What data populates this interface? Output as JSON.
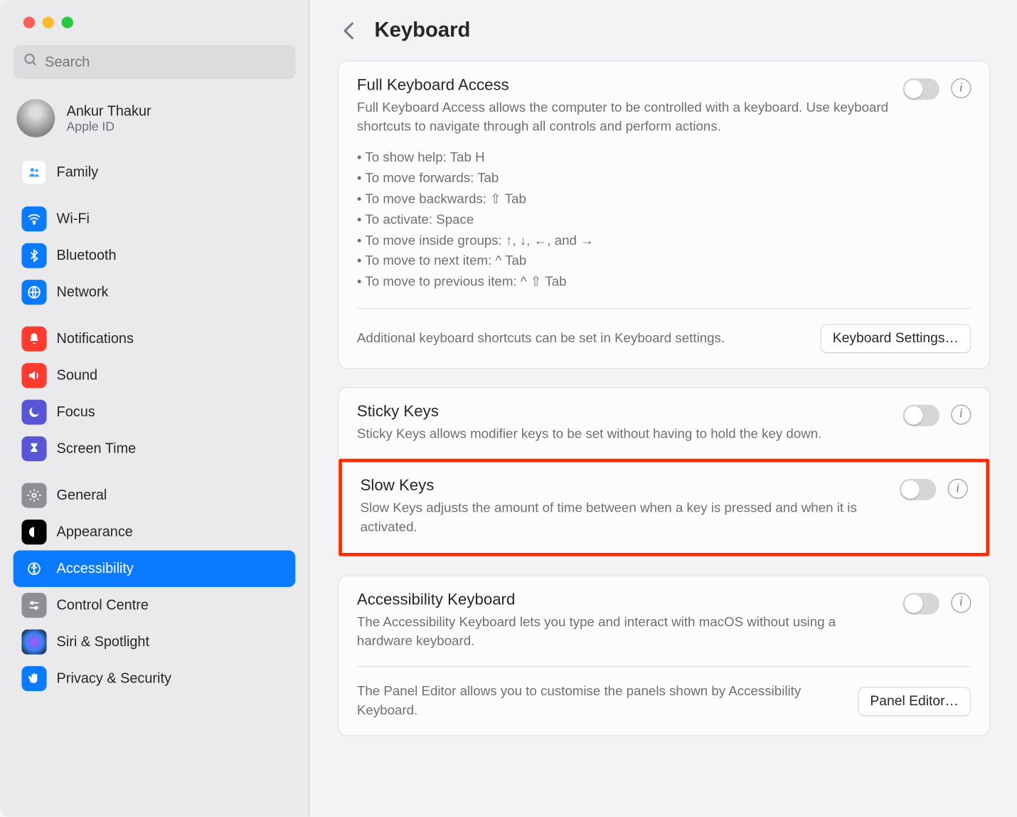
{
  "header": {
    "page_title": "Keyboard"
  },
  "search": {
    "placeholder": "Search"
  },
  "account": {
    "name": "Ankur Thakur",
    "sub": "Apple ID"
  },
  "sidebar": {
    "items": [
      {
        "label": "Family"
      },
      {
        "label": "Wi-Fi"
      },
      {
        "label": "Bluetooth"
      },
      {
        "label": "Network"
      },
      {
        "label": "Notifications"
      },
      {
        "label": "Sound"
      },
      {
        "label": "Focus"
      },
      {
        "label": "Screen Time"
      },
      {
        "label": "General"
      },
      {
        "label": "Appearance"
      },
      {
        "label": "Accessibility"
      },
      {
        "label": "Control Centre"
      },
      {
        "label": "Siri & Spotlight"
      },
      {
        "label": "Privacy & Security"
      }
    ]
  },
  "panels": {
    "full_keyboard": {
      "title": "Full Keyboard Access",
      "desc": "Full Keyboard Access allows the computer to be controlled with a keyboard. Use keyboard shortcuts to navigate through all controls and perform actions.",
      "shortcuts": [
        "To show help: Tab H",
        "To move forwards: Tab",
        "To move backwards: ⇧ Tab",
        "To activate: Space",
        "To move inside groups: ↑, ↓, ←, and →",
        "To move to next item: ^ Tab",
        "To move to previous item: ^ ⇧ Tab"
      ],
      "footer_text": "Additional keyboard shortcuts can be set in Keyboard settings.",
      "button": "Keyboard Settings…"
    },
    "sticky": {
      "title": "Sticky Keys",
      "desc": "Sticky Keys allows modifier keys to be set without having to hold the key down."
    },
    "slow": {
      "title": "Slow Keys",
      "desc": "Slow Keys adjusts the amount of time between when a key is pressed and when it is activated."
    },
    "accessibility_kb": {
      "title": "Accessibility Keyboard",
      "desc": "The Accessibility Keyboard lets you type and interact with macOS without using a hardware keyboard.",
      "footer_text": "The Panel Editor allows you to customise the panels shown by Accessibility Keyboard.",
      "button": "Panel Editor…"
    }
  }
}
